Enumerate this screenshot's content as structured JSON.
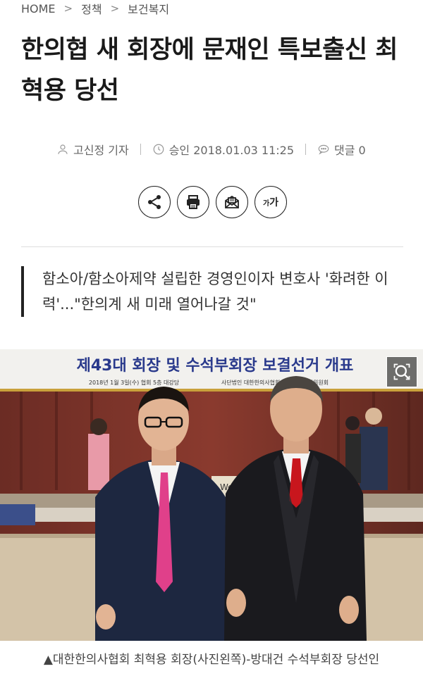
{
  "breadcrumb": {
    "home": "HOME",
    "section": "정책",
    "subsection": "보건복지"
  },
  "article": {
    "title": "한의협 새 회장에 문재인 특보출신 최혁용 당선",
    "subtitle": "함소아/함소아제약 설립한 경영인이자 변호사 '화려한 이력'...\"한의계 새 미래 열어나갈 것\""
  },
  "meta": {
    "reporter": "고신정 기자",
    "approved": "승인 2018.01.03 11:25",
    "comments": "댓글 0"
  },
  "share": {
    "font_size_label_small": "가",
    "font_size_label_large": "가"
  },
  "photo": {
    "banner_text": "제43대 회장 및 수석부회장 보결선거 개표",
    "banner_sub": "2018년 1월 3일(수) 협회 5층 대강당",
    "banner_org": "사단법인 대한한의사협회 중앙선거관리위원회",
    "sign_text": "We"
  },
  "caption": "▲대한한의사협회 최혁용 회장(사진왼쪽)-방대건 수석부회장 당선인",
  "colors": {
    "accent": "#222222",
    "tie_left": "#e0408a",
    "tie_right": "#c8161d",
    "banner_text": "#2a3a8c"
  }
}
